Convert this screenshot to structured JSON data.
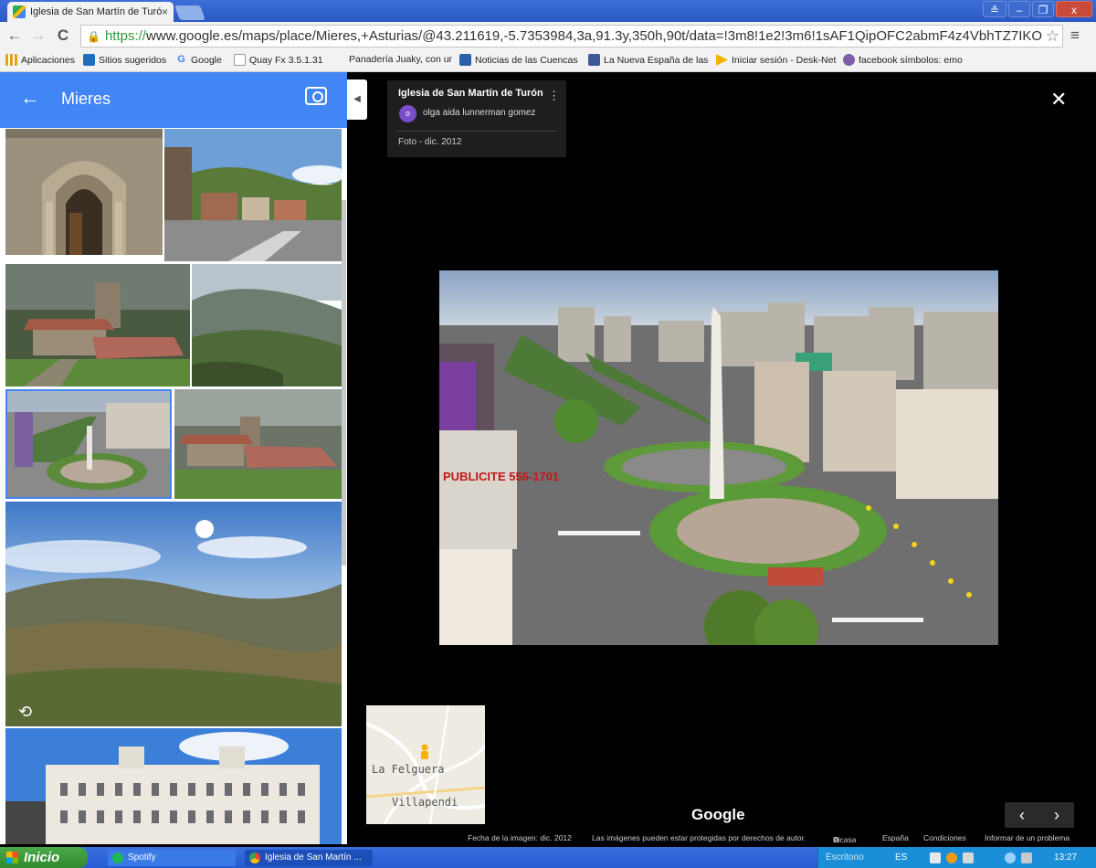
{
  "browser": {
    "tab_title": "Iglesia de San Martín de Turó",
    "tab_close": "×",
    "window_buttons": [
      "≗",
      "–",
      "❐",
      "x"
    ],
    "address": {
      "scheme": "https://",
      "rest": "www.google.es/maps/place/Mieres,+Asturias/@43.211619,-5.7353984,3a,91.3y,350h,90t/data=!3m8!1e2!3m6!1sAF1QipOFC2abmF4z4VbhTZ7IKO",
      "lock_icon": "🔒",
      "star_icon": "☆"
    },
    "nav": {
      "back": "←",
      "forward": "→",
      "reload": "C",
      "menu": "≡"
    },
    "bookmarks": [
      {
        "label": "Aplicaciones",
        "color": "#e0a020"
      },
      {
        "label": "Sitios sugeridos",
        "color": "#1e6fbf"
      },
      {
        "label": "Google",
        "color": "#ffffff",
        "glyph": "G"
      },
      {
        "label": "Quay Fx 3.5.1.31",
        "color": "#ffffff"
      },
      {
        "label": "Panadería Juaky, con ur",
        "color": "#f2f2f2"
      },
      {
        "label": "Noticias de las Cuencas",
        "color": "#2a5faa"
      },
      {
        "label": "La Nueva España de las",
        "color": "#3b5998"
      },
      {
        "label": "Iniciar sesión - Desk-Net",
        "color": "#f0b400"
      },
      {
        "label": "facebook símbolos: emo",
        "color": "#7d5fa8"
      }
    ]
  },
  "panel": {
    "back_icon": "←",
    "title": "Mieres"
  },
  "viewer": {
    "collapse_icon": "◀",
    "place_name": "Iglesia de San Martín de Turón",
    "avatar_letter": "o",
    "author": "olga aida lunnerman gomez",
    "date": "Foto - dic. 2012",
    "more_icon": "⋮",
    "close_icon": "✕",
    "main_photo_sign": "PUBLICITE 556-1701",
    "minimap": {
      "label1": "La Felguera",
      "label2": "Villapendi"
    },
    "google_logo": "Google",
    "pager": {
      "prev": "‹",
      "next": "›"
    },
    "footer": [
      "Fecha de la imagen: dic. 2012",
      "Las imágenes pueden estar protegidas por derechos de autor.",
      "Picasa",
      "España",
      "Condiciones",
      "Informar de un problema"
    ]
  },
  "taskbar": {
    "start": "Inicio",
    "tasks": [
      {
        "label": "Spotify",
        "color": "#1db954"
      },
      {
        "label": "Iglesia de San Martín ...",
        "color": "#4285f4"
      }
    ],
    "tray": {
      "desktop": "Escritorio",
      "lang": "ES",
      "clock": "13:27"
    }
  }
}
